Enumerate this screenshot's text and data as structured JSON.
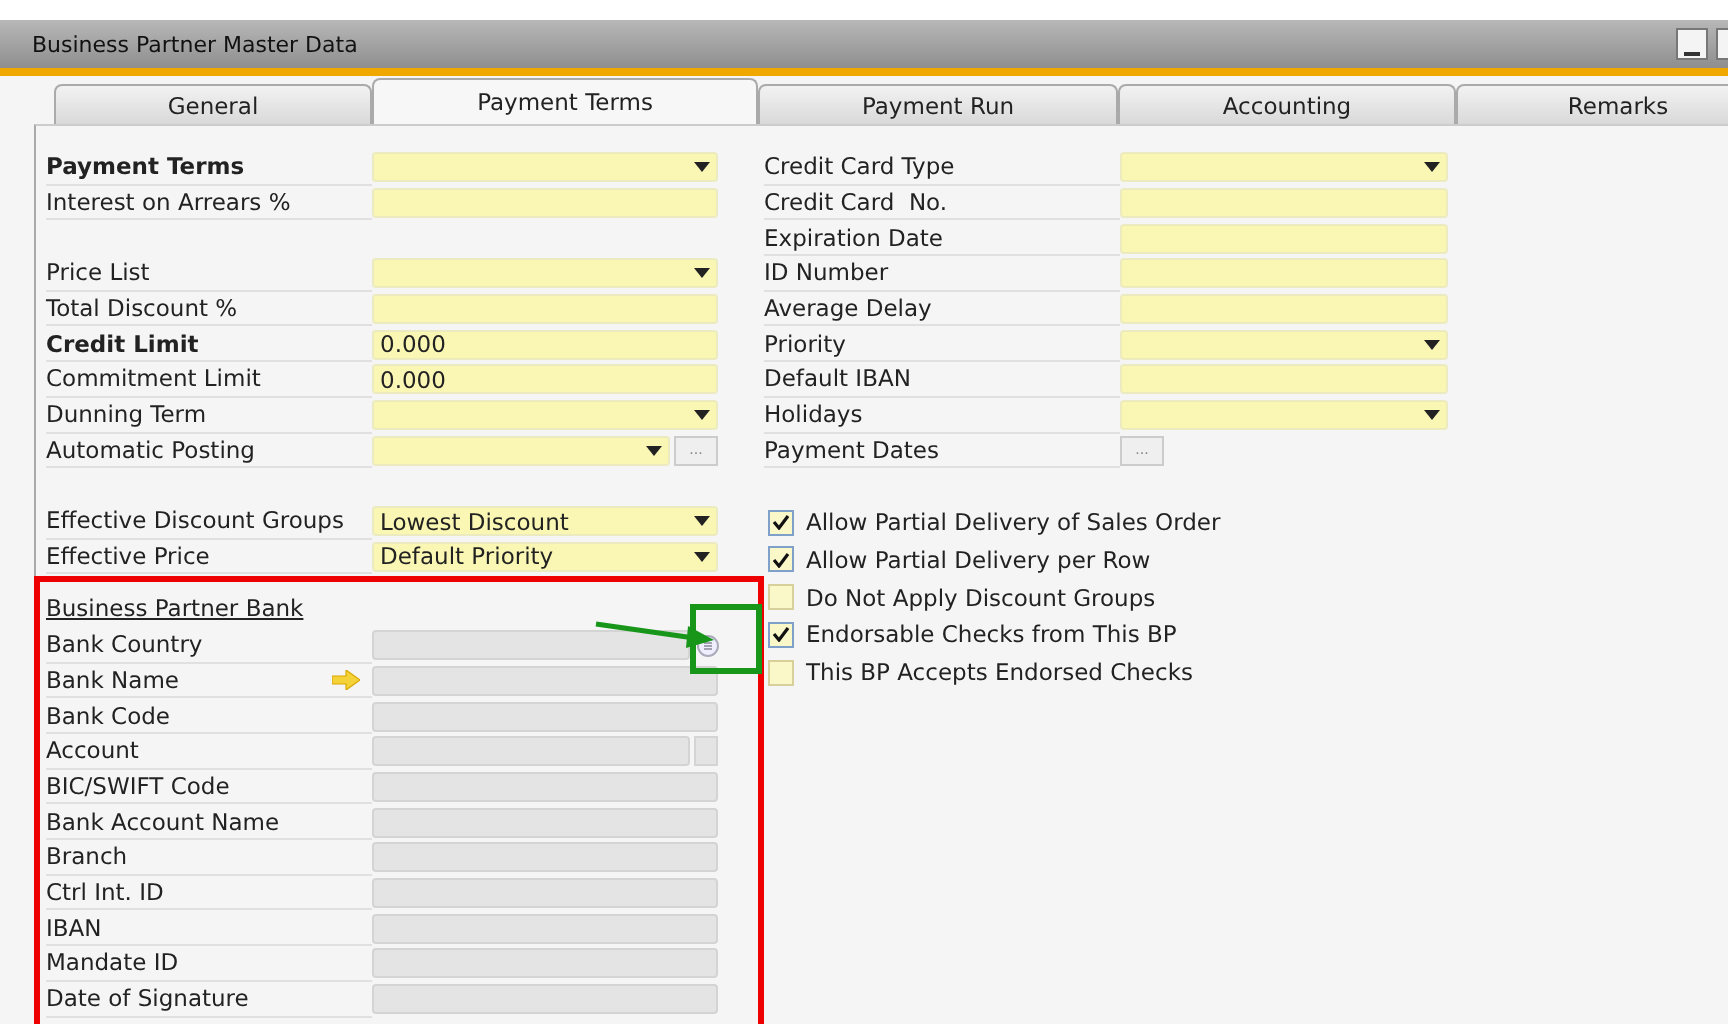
{
  "window": {
    "title": "Business Partner Master Data"
  },
  "tabs": [
    {
      "label": "General",
      "selected": false
    },
    {
      "label": "Payment Terms",
      "selected": true
    },
    {
      "label": "Payment Run",
      "selected": false
    },
    {
      "label": "Accounting",
      "selected": false
    },
    {
      "label": "Remarks",
      "selected": false
    }
  ],
  "left_groups": [
    [
      {
        "label": "Payment Terms",
        "bold": true,
        "kind": "dropdown"
      },
      {
        "label": "Interest on Arrears %",
        "bold": false,
        "kind": "text"
      }
    ],
    [
      {
        "label": "Price List",
        "bold": false,
        "kind": "dropdown"
      },
      {
        "label": "Total Discount %",
        "bold": false,
        "kind": "text"
      },
      {
        "label": "Credit Limit",
        "bold": true,
        "kind": "text",
        "value": "0.000"
      },
      {
        "label": "Commitment Limit",
        "bold": false,
        "kind": "text",
        "value": "0.000"
      },
      {
        "label": "Dunning Term",
        "bold": false,
        "kind": "dropdown"
      },
      {
        "label": "Automatic Posting",
        "bold": false,
        "kind": "dropdown_more",
        "button_text": "..."
      }
    ],
    [
      {
        "label": "Effective Discount Groups",
        "bold": false,
        "kind": "dropdown",
        "value": "Lowest Discount"
      },
      {
        "label": "Effective Price",
        "bold": false,
        "kind": "dropdown",
        "value": "Default Priority"
      }
    ]
  ],
  "right_fields": [
    {
      "label": "Credit Card Type",
      "kind": "dropdown"
    },
    {
      "label": "Credit Card  No.",
      "kind": "text"
    },
    {
      "label": "Expiration Date",
      "kind": "text"
    },
    {
      "label": "ID Number",
      "kind": "text"
    },
    {
      "label": "Average Delay",
      "kind": "text"
    },
    {
      "label": "Priority",
      "kind": "dropdown"
    },
    {
      "label": "Default IBAN",
      "kind": "text"
    },
    {
      "label": "Holidays",
      "kind": "dropdown"
    },
    {
      "label": "Payment Dates",
      "kind": "more",
      "button_text": "..."
    }
  ],
  "checkboxes": [
    {
      "label": "Allow Partial Delivery of Sales Order",
      "checked": true
    },
    {
      "label": "Allow Partial Delivery per Row",
      "checked": true
    },
    {
      "label": "Do Not Apply Discount Groups",
      "checked": false
    },
    {
      "label": "Endorsable Checks from This BP",
      "checked": true
    },
    {
      "label": "This BP Accepts Endorsed Checks",
      "checked": false
    }
  ],
  "bank": {
    "title": "Business Partner Bank",
    "fields": [
      {
        "label": "Bank Country",
        "kind": "lookup"
      },
      {
        "label": "Bank Name",
        "kind": "linked"
      },
      {
        "label": "Bank Code",
        "kind": "plain"
      },
      {
        "label": "Account",
        "kind": "split"
      },
      {
        "label": "BIC/SWIFT Code",
        "kind": "plain"
      },
      {
        "label": "Bank Account Name",
        "kind": "plain"
      },
      {
        "label": "Branch",
        "kind": "plain"
      },
      {
        "label": "Ctrl Int. ID",
        "kind": "plain"
      },
      {
        "label": "IBAN",
        "kind": "plain"
      },
      {
        "label": "Mandate ID",
        "kind": "plain"
      },
      {
        "label": "Date of Signature",
        "kind": "plain"
      }
    ]
  }
}
